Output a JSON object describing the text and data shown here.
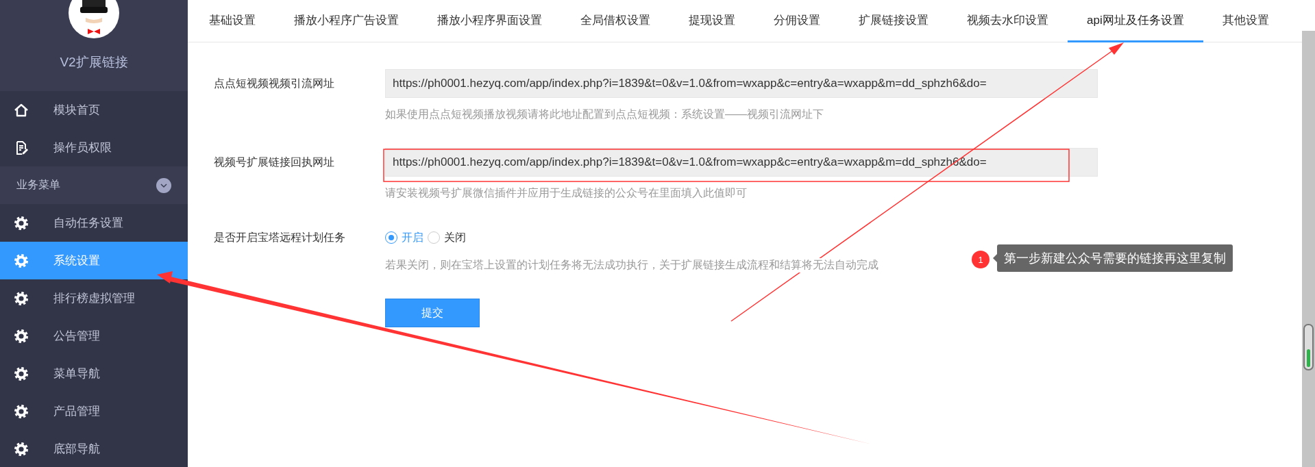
{
  "sidebar": {
    "title": "V2扩展链接",
    "items": [
      {
        "kind": "item",
        "label": "模块首页",
        "selected": false
      },
      {
        "kind": "item",
        "label": "操作员权限",
        "selected": false
      },
      {
        "kind": "group",
        "label": "业务菜单"
      },
      {
        "kind": "item",
        "label": "自动任务设置",
        "selected": false
      },
      {
        "kind": "item",
        "label": "系统设置",
        "selected": true
      },
      {
        "kind": "item",
        "label": "排行榜虚拟管理",
        "selected": false
      },
      {
        "kind": "item",
        "label": "公告管理",
        "selected": false
      },
      {
        "kind": "item",
        "label": "菜单导航",
        "selected": false
      },
      {
        "kind": "item",
        "label": "产品管理",
        "selected": false
      },
      {
        "kind": "item",
        "label": "底部导航",
        "selected": false
      }
    ]
  },
  "tabs": [
    {
      "label": "基础设置",
      "selected": false
    },
    {
      "label": "播放小程序广告设置",
      "selected": false
    },
    {
      "label": "播放小程序界面设置",
      "selected": false
    },
    {
      "label": "全局借权设置",
      "selected": false
    },
    {
      "label": "提现设置",
      "selected": false
    },
    {
      "label": "分佣设置",
      "selected": false
    },
    {
      "label": "扩展链接设置",
      "selected": false
    },
    {
      "label": "视频去水印设置",
      "selected": false
    },
    {
      "label": "api网址及任务设置",
      "selected": true
    },
    {
      "label": "其他设置",
      "selected": false
    }
  ],
  "form": {
    "rows": [
      {
        "kind": "text",
        "label": "点点短视频视频引流网址",
        "value": "https://ph0001.hezyq.com/app/index.php?i=1839&t=0&v=1.0&from=wxapp&c=entry&a=wxapp&m=dd_sphzh6&do=",
        "hint": "如果使用点点短视频播放视频请将此地址配置到点点短视频：系统设置——视频引流网址下"
      },
      {
        "kind": "text",
        "label": "视频号扩展链接回执网址",
        "value": "https://ph0001.hezyq.com/app/index.php?i=1839&t=0&v=1.0&from=wxapp&c=entry&a=wxapp&m=dd_sphzh6&do=",
        "hint": "请安装视频号扩展微信插件并应用于生成链接的公众号在里面填入此值即可"
      },
      {
        "kind": "radio",
        "label": "是否开启宝塔远程计划任务",
        "options": [
          {
            "label": "开启",
            "selected": true
          },
          {
            "label": "关闭",
            "selected": false
          }
        ],
        "hint": "若果关闭，则在宝塔上设置的计划任务将无法成功执行，关于扩展链接生成流程和结算将无法自动完成"
      }
    ],
    "submit": "提交"
  },
  "annotation": {
    "badge": "1",
    "text": "第一步新建公众号需要的链接再这里复制"
  }
}
